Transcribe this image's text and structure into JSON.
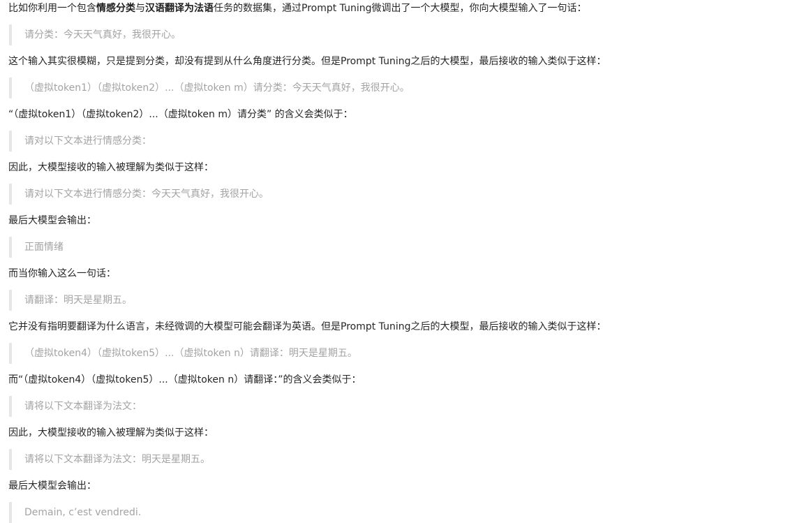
{
  "intro": {
    "pre": "比如你利用一个包含",
    "b1": "情感分类",
    "mid": "与",
    "b2": "汉语翻译为法语",
    "post": "任务的数据集，通过Prompt Tuning微调出了一个大模型，你向大模型输入了一句话："
  },
  "blocks": [
    {
      "type": "quote",
      "text": "请分类：今天天气真好，我很开心。"
    },
    {
      "type": "p",
      "text": "这个输入其实很模糊，只是提到分类，却没有提到从什么角度进行分类。但是Prompt Tuning之后的大模型，最后接收的输入类似于这样："
    },
    {
      "type": "quote",
      "text": "（虚拟token1）（虚拟token2）...（虚拟token m）请分类：今天天气真好，我很开心。"
    },
    {
      "type": "p",
      "text": "“（虚拟token1）（虚拟token2）...（虚拟token m）请分类” 的含义会类似于："
    },
    {
      "type": "quote",
      "text": "请对以下文本进行情感分类："
    },
    {
      "type": "p",
      "text": "因此，大模型接收的输入被理解为类似于这样："
    },
    {
      "type": "quote",
      "text": "请对以下文本进行情感分类：今天天气真好，我很开心。"
    },
    {
      "type": "p",
      "text": "最后大模型会输出："
    },
    {
      "type": "quote",
      "text": "正面情绪"
    },
    {
      "type": "p",
      "text": "而当你输入这么一句话："
    },
    {
      "type": "quote",
      "text": "请翻译：明天是星期五。"
    },
    {
      "type": "p",
      "text": "它并没有指明要翻译为什么语言，未经微调的大模型可能会翻译为英语。但是Prompt Tuning之后的大模型，最后接收的输入类似于这样："
    },
    {
      "type": "quote",
      "text": "（虚拟token4）（虚拟token5）...（虚拟token n）请翻译：明天是星期五。"
    },
    {
      "type": "p",
      "text": "而“（虚拟token4）（虚拟token5）...（虚拟token n）请翻译：”的含义会类似于："
    },
    {
      "type": "quote",
      "text": "请将以下文本翻译为法文："
    },
    {
      "type": "p",
      "text": "因此，大模型接收的输入被理解为类似于这样："
    },
    {
      "type": "quote",
      "text": "请将以下文本翻译为法文：明天是星期五。"
    },
    {
      "type": "p",
      "text": "最后大模型会输出："
    },
    {
      "type": "quote",
      "text": "Demain, c’est vendredi."
    }
  ]
}
